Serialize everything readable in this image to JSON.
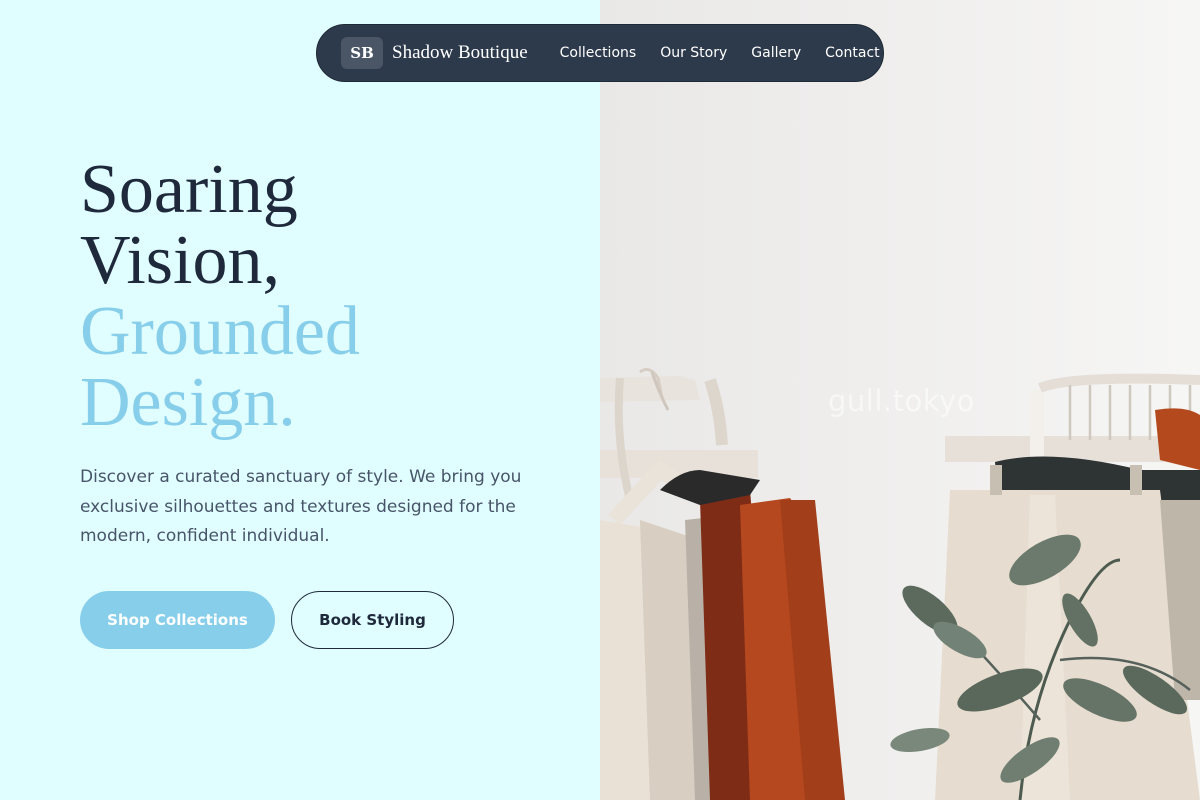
{
  "nav": {
    "logo_initials": "SB",
    "brand": "Shadow Boutique",
    "links": [
      {
        "label": "Collections"
      },
      {
        "label": "Our Story"
      },
      {
        "label": "Gallery"
      },
      {
        "label": "Contact"
      }
    ]
  },
  "hero": {
    "title_line1": "Soaring",
    "title_line2": "Vision,",
    "title_line3": "Grounded",
    "title_line4": "Design.",
    "description": "Discover a curated sanctuary of style. We bring you exclusive silhouettes and textures designed for the modern, confident individual.",
    "primary_button": "Shop Collections",
    "secondary_button": "Book Styling"
  },
  "image": {
    "watermark": "gull.tokyo"
  },
  "colors": {
    "background": "#e0fdff",
    "nav_bg": "#2d3a4b",
    "heading_dark": "#1e293b",
    "accent": "#87ceeb",
    "body_text": "#475569"
  }
}
